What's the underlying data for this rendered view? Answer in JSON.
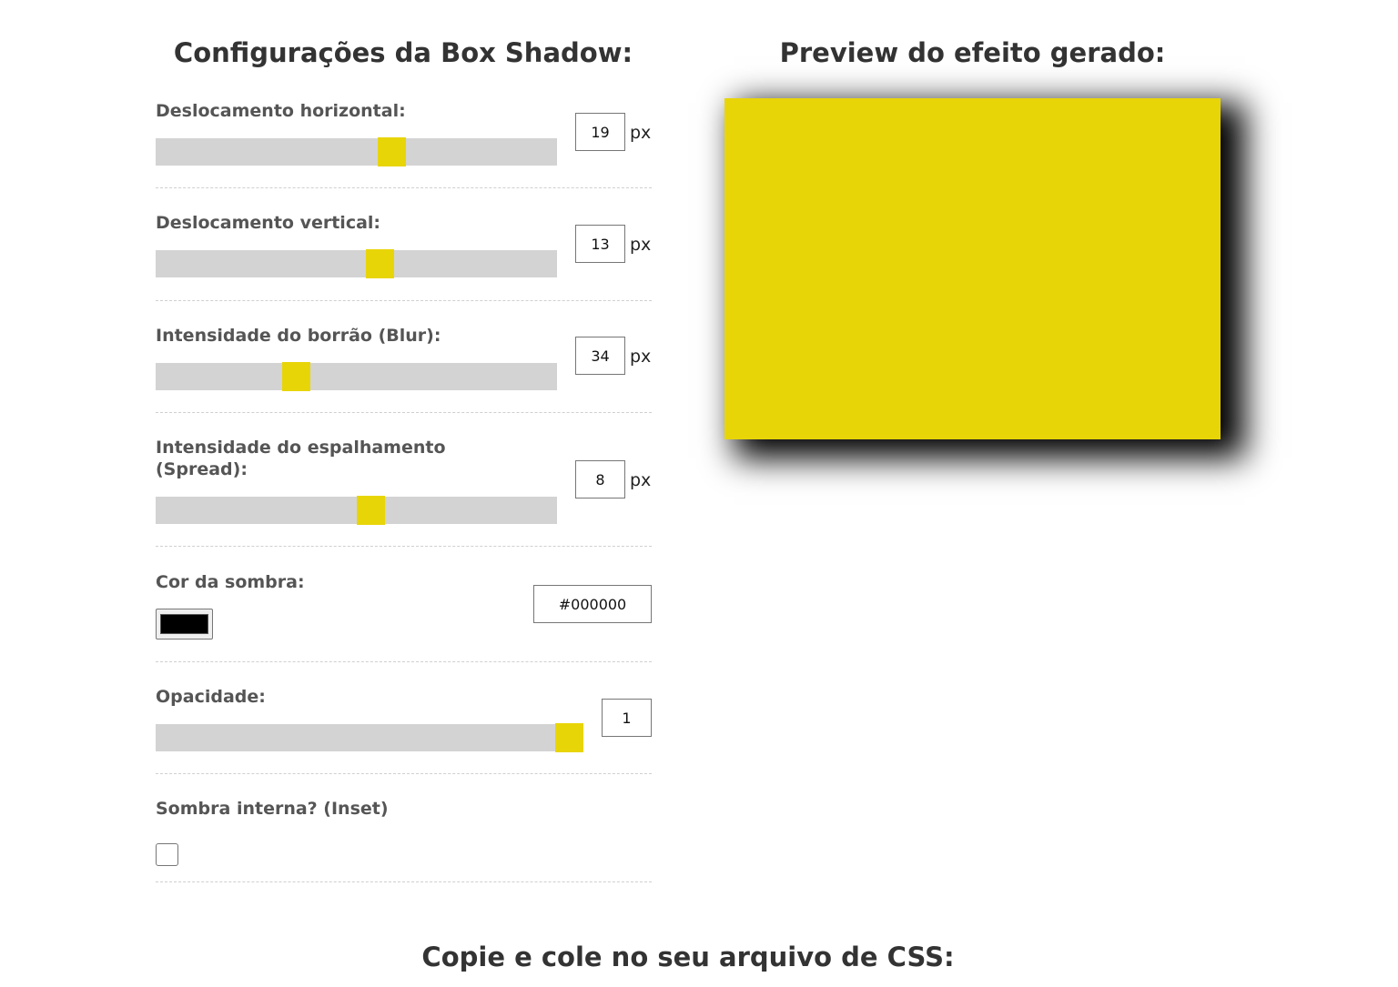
{
  "titles": {
    "config": "Configurações da Box Shadow:",
    "preview": "Preview do efeito gerado:",
    "copy": "Copie e cole no seu arquivo de CSS:"
  },
  "controls": {
    "horizontal": {
      "label": "Deslocamento horizontal:",
      "value": "19",
      "unit": "px"
    },
    "vertical": {
      "label": "Deslocamento vertical:",
      "value": "13",
      "unit": "px"
    },
    "blur": {
      "label": "Intensidade do borrão (Blur):",
      "value": "34",
      "unit": "px"
    },
    "spread": {
      "label": "Intensidade do espalhamento (Spread):",
      "value": "8",
      "unit": "px"
    },
    "color": {
      "label": "Cor da sombra:",
      "value": "#000000"
    },
    "opacity": {
      "label": "Opacidade:",
      "value": "1"
    },
    "inset": {
      "label": "Sombra interna? (Inset)",
      "checked": false
    }
  },
  "colors": {
    "accent": "#e8d508",
    "track": "#d3d3d3",
    "shadow": "#000000"
  }
}
